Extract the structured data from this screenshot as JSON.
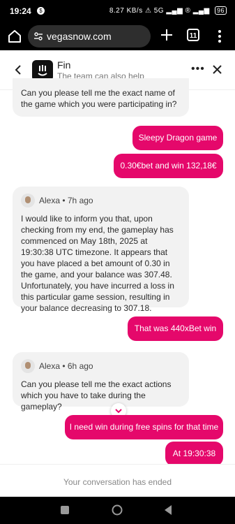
{
  "status_bar": {
    "time": "19:24",
    "speed": "8.27 KB/s",
    "battery": "96",
    "network": "5G"
  },
  "browser": {
    "url": "vegasnow.com",
    "tab_count": "11"
  },
  "chat_header": {
    "name": "Fin",
    "subtitle": "The team can also help"
  },
  "messages": [
    {
      "sender": "agent",
      "text": "Can you please tell me the exact name of the game which you were participating in?"
    },
    {
      "sender": "user",
      "text": "Sleepy Dragon game"
    },
    {
      "sender": "user",
      "text": "0.30€bet and win 132,18€"
    },
    {
      "sender": "agent",
      "author": "Alexa",
      "time": "7h ago",
      "author_line": "Alexa • 7h ago",
      "text": "I would like to inform you that, upon checking from my end, the gameplay has commenced on May 18th, 2025 at 19:30:38 UTC timezone. It appears that you have placed a bet amount of 0.30 in the game, and your balance was 307.48. Unfortunately, you have incurred a loss in this particular game session, resulting in your balance decreasing to 307.18."
    },
    {
      "sender": "user",
      "text": "That was 440xBet win"
    },
    {
      "sender": "agent",
      "author": "Alexa",
      "time": "6h ago",
      "author_line": "Alexa • 6h ago",
      "text": "Can you please tell me the exact actions which you have to take during the gameplay?"
    },
    {
      "sender": "user",
      "text": "I need win during free spins for that time"
    },
    {
      "sender": "user",
      "text": "At 19:30:38"
    }
  ],
  "footer": {
    "ended_text": "Your conversation has ended"
  },
  "colors": {
    "user_bubble": "#e5086b",
    "agent_bubble": "#f2f2f2"
  }
}
